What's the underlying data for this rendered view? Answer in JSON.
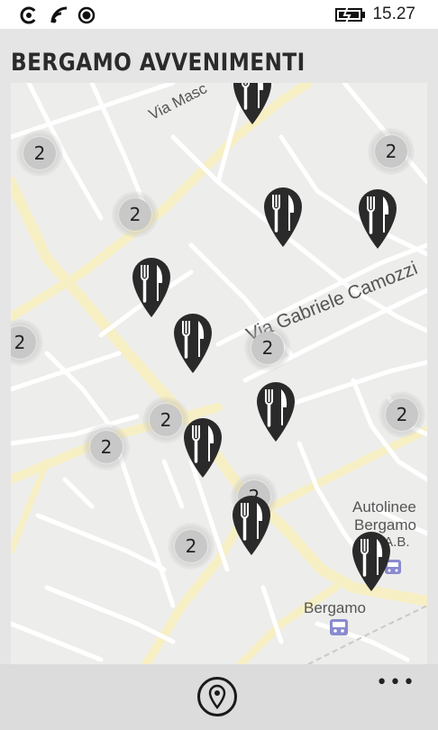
{
  "statusbar": {
    "time": "15.27",
    "icons": [
      "signal-icon",
      "wifi-icon",
      "gps-icon",
      "battery-icon"
    ]
  },
  "page": {
    "title": "BERGAMO AVVENIMENTI"
  },
  "map": {
    "labels": {
      "street1": "Via Masc",
      "street2": "Via Gabriele Camozzi",
      "poi1_line1": "Autolinee",
      "poi1_line2": "Bergamo",
      "poi1_line3": "S.A.B.",
      "station": "Bergamo"
    },
    "clusters": [
      {
        "count": "2"
      },
      {
        "count": "2"
      },
      {
        "count": "2"
      },
      {
        "count": "2"
      },
      {
        "count": "2"
      },
      {
        "count": "2"
      },
      {
        "count": "2"
      },
      {
        "count": "2"
      },
      {
        "count": "2"
      },
      {
        "count": "2"
      }
    ],
    "pin_icon": "restaurant-icon"
  },
  "appbar": {
    "location_icon": "location-pin-icon",
    "more_label": "•••"
  },
  "colors": {
    "main_road": "#f7efc4",
    "street": "#ffffff",
    "map_bg": "#ededeb",
    "pin": "#2a2a2a"
  }
}
